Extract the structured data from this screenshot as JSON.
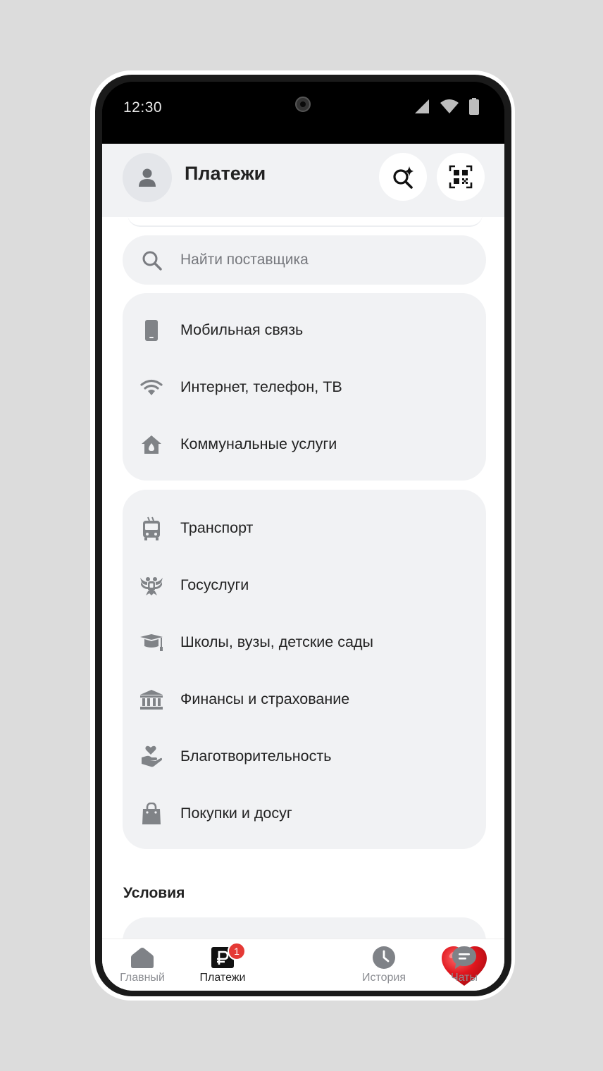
{
  "status_bar": {
    "time": "12:30"
  },
  "header": {
    "title": "Платежи",
    "avatar_icon": "person-icon",
    "search_ai_icon": "sparkle-search-icon",
    "qr_icon": "qr-code-icon"
  },
  "search": {
    "placeholder": "Найти поставщика",
    "value": ""
  },
  "groups": [
    {
      "items": [
        {
          "label": "Мобильная связь",
          "icon": "phone-icon"
        },
        {
          "label": "Интернет, телефон, ТВ",
          "icon": "wifi-icon"
        },
        {
          "label": "Коммунальные услуги",
          "icon": "house-icon"
        }
      ]
    },
    {
      "items": [
        {
          "label": "Транспорт",
          "icon": "trolleybus-icon"
        },
        {
          "label": "Госуслуги",
          "icon": "eagle-emblem-icon"
        },
        {
          "label": "Школы, вузы, детские сады",
          "icon": "graduation-cap-icon"
        },
        {
          "label": "Финансы и страхование",
          "icon": "bank-icon"
        },
        {
          "label": "Благотворительность",
          "icon": "heart-hand-icon"
        },
        {
          "label": "Покупки и досуг",
          "icon": "shopping-bag-icon"
        }
      ]
    }
  ],
  "conditions": {
    "title": "Условия"
  },
  "tabbar": {
    "tabs": [
      {
        "label": "Главный",
        "icon": "home-icon",
        "active": false
      },
      {
        "label": "Платежи",
        "icon": "ruble-card-icon",
        "active": true,
        "badge": "1"
      },
      {
        "label": "",
        "icon": "heart-icon",
        "active": false
      },
      {
        "label": "История",
        "icon": "clock-icon",
        "active": false
      },
      {
        "label": "Чаты",
        "icon": "chat-bubble-icon",
        "active": false
      }
    ]
  },
  "colors": {
    "background": "#dcdcdc",
    "surface": "#f1f2f4",
    "icon_gray": "#808387",
    "badge": "#e53935",
    "heart": "#e0161e"
  }
}
